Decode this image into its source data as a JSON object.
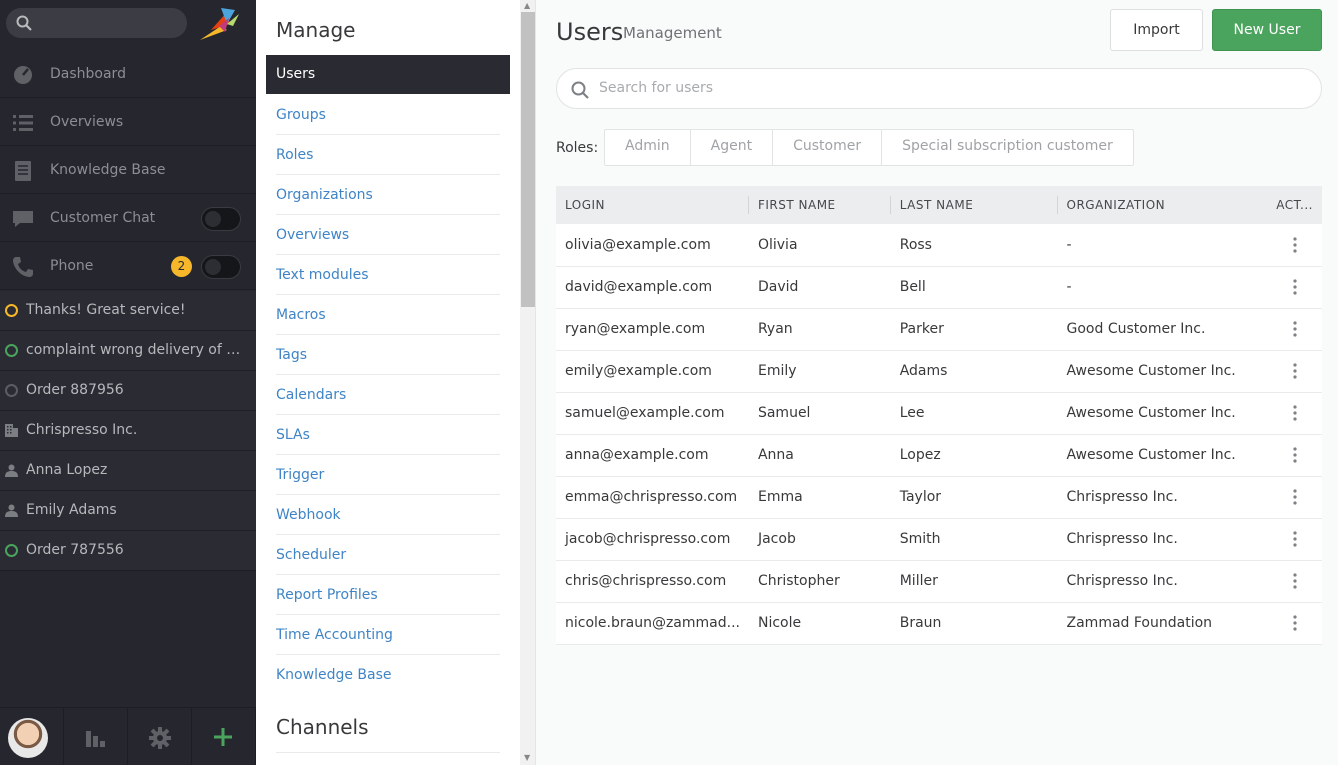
{
  "nav": {
    "search_placeholder": "",
    "items": [
      {
        "label": "Dashboard",
        "icon": "dashboard-icon"
      },
      {
        "label": "Overviews",
        "icon": "list-icon"
      },
      {
        "label": "Knowledge Base",
        "icon": "book-icon"
      },
      {
        "label": "Customer Chat",
        "icon": "chat-icon"
      },
      {
        "label": "Phone",
        "icon": "phone-icon",
        "badge": "2"
      }
    ],
    "tasks": [
      {
        "label": "Thanks! Great service!",
        "icon": "ticket-pending-icon",
        "color": "#f6b72b"
      },
      {
        "label": "complaint wrong delivery of ord...",
        "icon": "ticket-open-icon",
        "color": "#4ba45d"
      },
      {
        "label": "Order 887956",
        "icon": "ticket-closed-icon",
        "color": "#5b5d62"
      },
      {
        "label": "Chrispresso Inc.",
        "icon": "organization-icon"
      },
      {
        "label": "Anna Lopez",
        "icon": "user-icon"
      },
      {
        "label": "Emily Adams",
        "icon": "user-icon"
      },
      {
        "label": "Order 787556",
        "icon": "ticket-open-icon",
        "color": "#4ba45d"
      }
    ],
    "bottom": [
      "avatar",
      "report-icon",
      "gear-icon",
      "plus-icon"
    ]
  },
  "manage": {
    "title": "Manage",
    "items": [
      "Users",
      "Groups",
      "Roles",
      "Organizations",
      "Overviews",
      "Text modules",
      "Macros",
      "Tags",
      "Calendars",
      "SLAs",
      "Trigger",
      "Webhook",
      "Scheduler",
      "Report Profiles",
      "Time Accounting",
      "Knowledge Base"
    ],
    "channels_title": "Channels"
  },
  "main": {
    "title": "Users",
    "subtitle": "Management",
    "import_label": "Import",
    "new_label": "New User",
    "search_placeholder": "Search for users",
    "roles_label": "Roles:",
    "roles": [
      "Admin",
      "Agent",
      "Customer",
      "Special subscription customer"
    ],
    "columns": [
      "LOGIN",
      "FIRST NAME",
      "LAST NAME",
      "ORGANIZATION",
      "ACT..."
    ],
    "rows": [
      [
        "olivia@example.com",
        "Olivia",
        "Ross",
        "-"
      ],
      [
        "david@example.com",
        "David",
        "Bell",
        "-"
      ],
      [
        "ryan@example.com",
        "Ryan",
        "Parker",
        "Good Customer Inc."
      ],
      [
        "emily@example.com",
        "Emily",
        "Adams",
        "Awesome Customer Inc."
      ],
      [
        "samuel@example.com",
        "Samuel",
        "Lee",
        "Awesome Customer Inc."
      ],
      [
        "anna@example.com",
        "Anna",
        "Lopez",
        "Awesome Customer Inc."
      ],
      [
        "emma@chrispresso.com",
        "Emma",
        "Taylor",
        "Chrispresso Inc."
      ],
      [
        "jacob@chrispresso.com",
        "Jacob",
        "Smith",
        "Chrispresso Inc."
      ],
      [
        "chris@chrispresso.com",
        "Christopher",
        "Miller",
        "Chrispresso Inc."
      ],
      [
        "nicole.braun@zammad...",
        "Nicole",
        "Braun",
        "Zammad Foundation"
      ]
    ],
    "accent": "#4ba45d",
    "link": "#3f84c6"
  }
}
